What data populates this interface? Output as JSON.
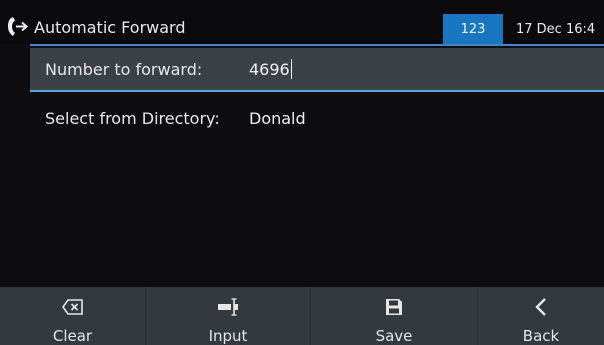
{
  "header": {
    "title": "Automatic Forward",
    "mode_badge": "123",
    "datetime": "17 Dec 16:4",
    "title_icon": "call-forward-icon"
  },
  "form": {
    "number_label": "Number to forward:",
    "number_value": "4696",
    "directory_label": "Select from Directory:",
    "directory_value": "Donald"
  },
  "softkeys": [
    {
      "label": "Clear",
      "icon": "backspace-icon"
    },
    {
      "label": "Input",
      "icon": "input-mode-icon"
    },
    {
      "label": "Save",
      "icon": "save-icon"
    },
    {
      "label": "Back",
      "icon": "chevron-left-icon"
    }
  ],
  "colors": {
    "accent": "#1976c0",
    "focus_line": "#53a6e0",
    "selected_row": "#3b4147",
    "softkey_bar": "#33393f"
  }
}
